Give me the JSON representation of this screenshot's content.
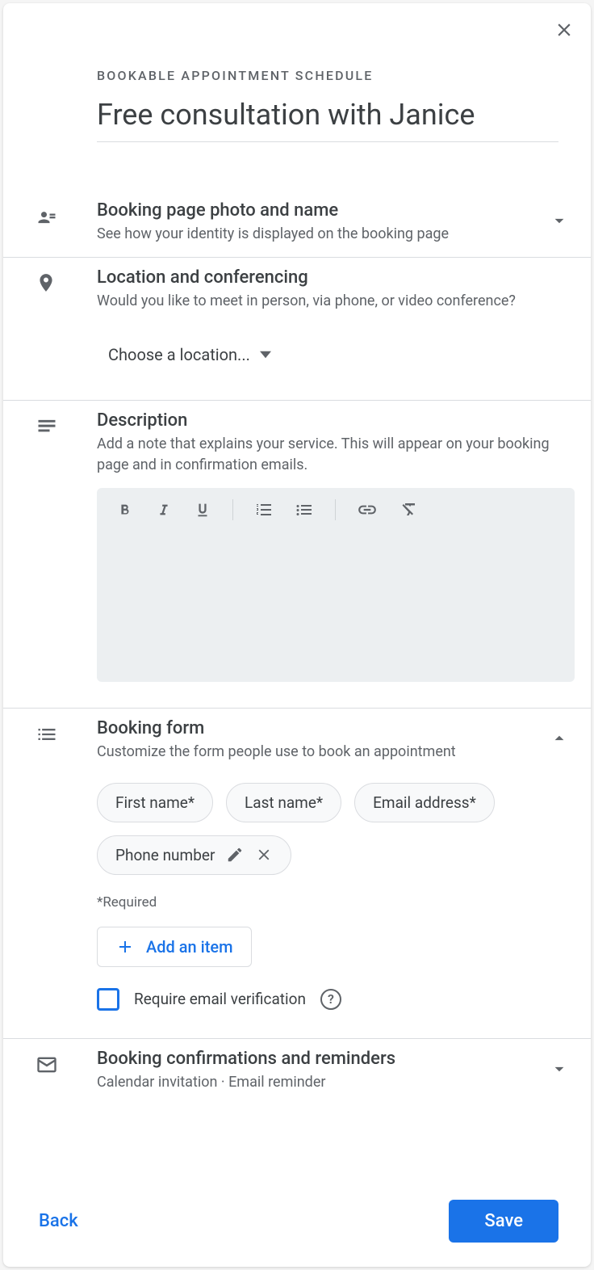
{
  "overline": "BOOKABLE APPOINTMENT SCHEDULE",
  "title": "Free consultation with Janice",
  "sections": {
    "photo": {
      "heading": "Booking page photo and name",
      "sub": "See how your identity is displayed on the booking page"
    },
    "location": {
      "heading": "Location and conferencing",
      "sub": "Would you like to meet in person, via phone, or video conference?",
      "dropdown": "Choose a location..."
    },
    "description": {
      "heading": "Description",
      "sub": "Add a note that explains your service. This will appear on your booking page and in confirmation emails."
    },
    "form": {
      "heading": "Booking form",
      "sub": "Customize the form people use to book an appointment",
      "chips": {
        "first_name": "First name*",
        "last_name": "Last name*",
        "email": "Email address*",
        "phone": "Phone number"
      },
      "required_note": "*Required",
      "add_item": "Add an item",
      "verify_label": "Require email verification"
    },
    "confirmations": {
      "heading": "Booking confirmations and reminders",
      "sub": "Calendar invitation  ·  Email reminder"
    }
  },
  "footer": {
    "back": "Back",
    "save": "Save"
  }
}
